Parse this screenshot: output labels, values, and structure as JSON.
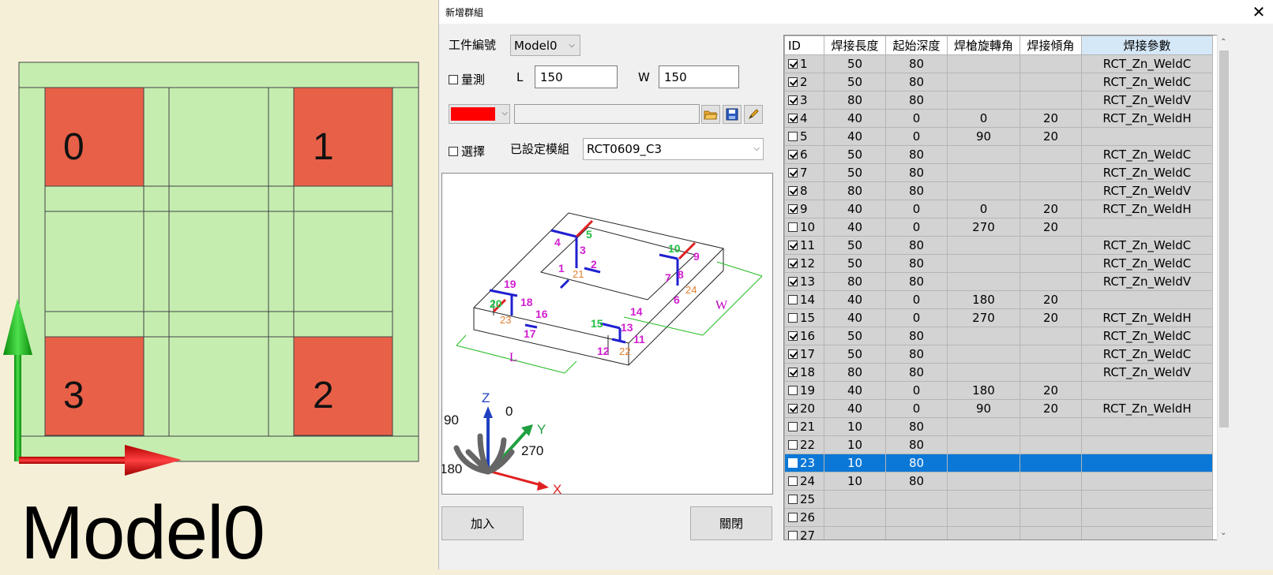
{
  "canvas": {
    "model_label": "Model0",
    "blocks": [
      "0",
      "1",
      "3",
      "2"
    ],
    "colors": {
      "background": "#f6efd8",
      "plate": "#c5edb0",
      "block": "#e86048",
      "axis_up": "#20b020",
      "axis_right": "#e02020"
    }
  },
  "dialog": {
    "title": "新增群組",
    "close": "✕",
    "part_no_label": "工件編號",
    "part_no_value": "Model0",
    "measure_label": "量測",
    "measure_checked": false,
    "l_label": "L",
    "l_value": "150",
    "w_label": "W",
    "w_value": "150",
    "color_value": "#ff0000",
    "path_value": "",
    "icons": [
      "folder-open-icon",
      "save-icon",
      "pencil-icon"
    ],
    "select_label": "選擇",
    "select_checked": false,
    "module_label": "已設定模組",
    "module_value": "RCT0609_C3",
    "add_button": "加入",
    "close_button": "關閉"
  },
  "preview": {
    "dim_l": "L",
    "dim_w": "W",
    "labels_green": [
      "5",
      "10",
      "20",
      "15"
    ],
    "labels_magenta": [
      "4",
      "3",
      "1",
      "2",
      "9",
      "7",
      "8",
      "6",
      "19",
      "18",
      "16",
      "17",
      "14",
      "13",
      "11",
      "12"
    ],
    "labels_orange": [
      "21",
      "24",
      "23",
      "22"
    ],
    "axes": {
      "z": "Z",
      "y": "Y",
      "x": "X",
      "a0": "0",
      "a90": "90",
      "a180": "180",
      "a270": "270"
    }
  },
  "grid": {
    "headers": [
      "ID",
      "焊接長度",
      "起始深度",
      "焊槍旋轉角",
      "焊接傾角",
      "焊接參數"
    ],
    "rows": [
      {
        "id": "1",
        "checked": true,
        "len": "50",
        "depth": "80",
        "rot": "",
        "tilt": "",
        "param": "RCT_Zn_WeldC"
      },
      {
        "id": "2",
        "checked": true,
        "len": "50",
        "depth": "80",
        "rot": "",
        "tilt": "",
        "param": "RCT_Zn_WeldC"
      },
      {
        "id": "3",
        "checked": true,
        "len": "80",
        "depth": "80",
        "rot": "",
        "tilt": "",
        "param": "RCT_Zn_WeldV"
      },
      {
        "id": "4",
        "checked": true,
        "len": "40",
        "depth": "0",
        "rot": "0",
        "tilt": "20",
        "param": "RCT_Zn_WeldH"
      },
      {
        "id": "5",
        "checked": false,
        "len": "40",
        "depth": "0",
        "rot": "90",
        "tilt": "20",
        "param": ""
      },
      {
        "id": "6",
        "checked": true,
        "len": "50",
        "depth": "80",
        "rot": "",
        "tilt": "",
        "param": "RCT_Zn_WeldC"
      },
      {
        "id": "7",
        "checked": true,
        "len": "50",
        "depth": "80",
        "rot": "",
        "tilt": "",
        "param": "RCT_Zn_WeldC"
      },
      {
        "id": "8",
        "checked": true,
        "len": "80",
        "depth": "80",
        "rot": "",
        "tilt": "",
        "param": "RCT_Zn_WeldV"
      },
      {
        "id": "9",
        "checked": true,
        "len": "40",
        "depth": "0",
        "rot": "0",
        "tilt": "20",
        "param": "RCT_Zn_WeldH"
      },
      {
        "id": "10",
        "checked": false,
        "len": "40",
        "depth": "0",
        "rot": "270",
        "tilt": "20",
        "param": ""
      },
      {
        "id": "11",
        "checked": true,
        "len": "50",
        "depth": "80",
        "rot": "",
        "tilt": "",
        "param": "RCT_Zn_WeldC"
      },
      {
        "id": "12",
        "checked": true,
        "len": "50",
        "depth": "80",
        "rot": "",
        "tilt": "",
        "param": "RCT_Zn_WeldC"
      },
      {
        "id": "13",
        "checked": true,
        "len": "80",
        "depth": "80",
        "rot": "",
        "tilt": "",
        "param": "RCT_Zn_WeldV"
      },
      {
        "id": "14",
        "checked": false,
        "len": "40",
        "depth": "0",
        "rot": "180",
        "tilt": "20",
        "param": ""
      },
      {
        "id": "15",
        "checked": false,
        "len": "40",
        "depth": "0",
        "rot": "270",
        "tilt": "20",
        "param": "RCT_Zn_WeldH"
      },
      {
        "id": "16",
        "checked": true,
        "len": "50",
        "depth": "80",
        "rot": "",
        "tilt": "",
        "param": "RCT_Zn_WeldC"
      },
      {
        "id": "17",
        "checked": true,
        "len": "50",
        "depth": "80",
        "rot": "",
        "tilt": "",
        "param": "RCT_Zn_WeldC"
      },
      {
        "id": "18",
        "checked": true,
        "len": "80",
        "depth": "80",
        "rot": "",
        "tilt": "",
        "param": "RCT_Zn_WeldV"
      },
      {
        "id": "19",
        "checked": false,
        "len": "40",
        "depth": "0",
        "rot": "180",
        "tilt": "20",
        "param": ""
      },
      {
        "id": "20",
        "checked": true,
        "len": "40",
        "depth": "0",
        "rot": "90",
        "tilt": "20",
        "param": "RCT_Zn_WeldH"
      },
      {
        "id": "21",
        "checked": false,
        "len": "10",
        "depth": "80",
        "rot": "",
        "tilt": "",
        "param": ""
      },
      {
        "id": "22",
        "checked": false,
        "len": "10",
        "depth": "80",
        "rot": "",
        "tilt": "",
        "param": ""
      },
      {
        "id": "23",
        "checked": false,
        "len": "10",
        "depth": "80",
        "rot": "",
        "tilt": "",
        "param": "",
        "selected": true
      },
      {
        "id": "24",
        "checked": false,
        "len": "10",
        "depth": "80",
        "rot": "",
        "tilt": "",
        "param": ""
      },
      {
        "id": "25",
        "checked": false,
        "len": "",
        "depth": "",
        "rot": "",
        "tilt": "",
        "param": ""
      },
      {
        "id": "26",
        "checked": false,
        "len": "",
        "depth": "",
        "rot": "",
        "tilt": "",
        "param": ""
      },
      {
        "id": "27",
        "checked": false,
        "len": "",
        "depth": "",
        "rot": "",
        "tilt": "",
        "param": ""
      }
    ]
  }
}
